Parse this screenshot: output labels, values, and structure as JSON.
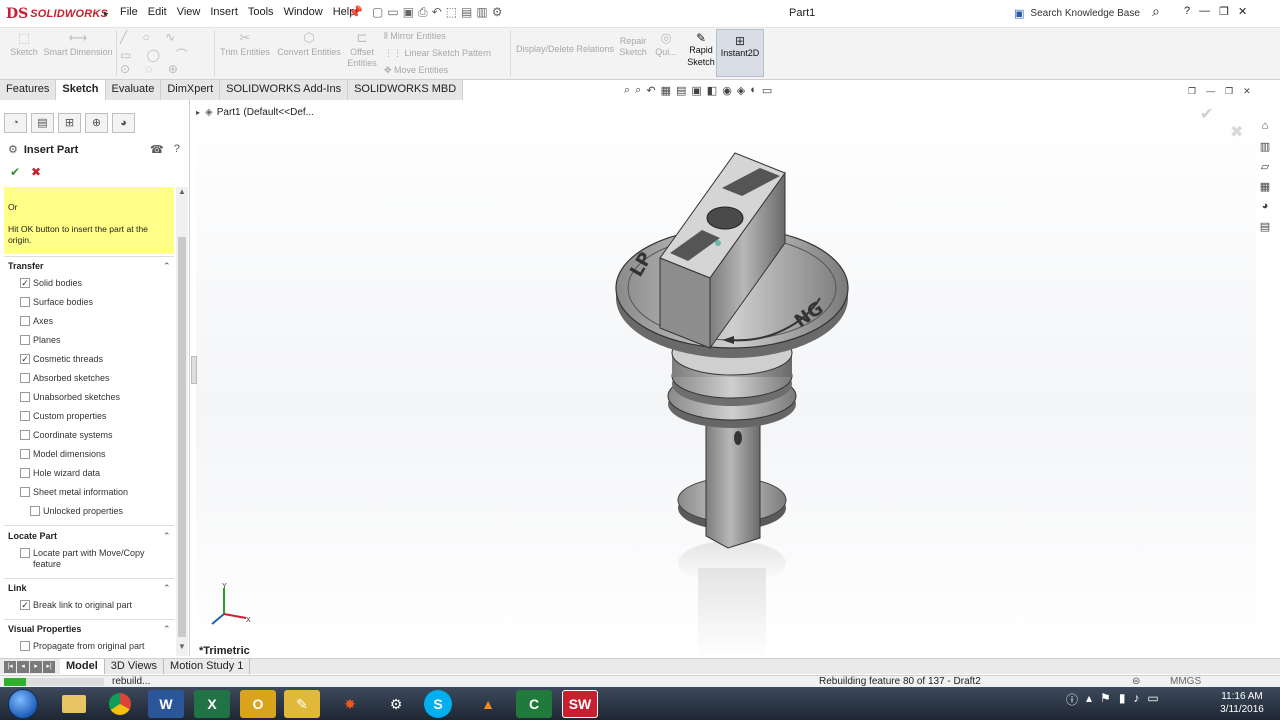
{
  "app": {
    "title": "Part1",
    "logo_ds": "DS",
    "logo_text": "SOLIDWORKS",
    "menus": [
      "File",
      "Edit",
      "View",
      "Insert",
      "Tools",
      "Window",
      "Help"
    ],
    "search_placeholder": "Search Knowledge Base",
    "help_label": "?"
  },
  "ribbon": {
    "sketch": "Sketch",
    "smart_dimension": "Smart Dimension",
    "trim": "Trim Entities",
    "convert": "Convert Entities",
    "offset_1": "Offset",
    "offset_2": "Entities",
    "mirror": "Mirror Entities",
    "linear_pattern": "Linear Sketch Pattern",
    "move": "Move Entities",
    "display_delete": "Display/Delete Relations",
    "repair_1": "Repair",
    "repair_2": "Sketch",
    "quick": "Qui...",
    "rapid_1": "Rapid",
    "rapid_2": "Sketch",
    "instant2d": "Instant2D"
  },
  "tabs": [
    "Features",
    "Sketch",
    "Evaluate",
    "DimXpert",
    "SOLIDWORKS Add-Ins",
    "SOLIDWORKS MBD"
  ],
  "active_tab": "Sketch",
  "tree": {
    "root": "Part1  (Default<<Def..."
  },
  "property_manager": {
    "title": "Insert Part",
    "message_or": "Or",
    "message_body": "Hit OK button to insert the part at the origin.",
    "transfer_title": "Transfer",
    "transfer_items": [
      {
        "label": "Solid bodies",
        "checked": true
      },
      {
        "label": "Surface bodies",
        "checked": false
      },
      {
        "label": "Axes",
        "checked": false
      },
      {
        "label": "Planes",
        "checked": false
      },
      {
        "label": "Cosmetic threads",
        "checked": true
      },
      {
        "label": "Absorbed sketches",
        "checked": false
      },
      {
        "label": "Unabsorbed sketches",
        "checked": false
      },
      {
        "label": "Custom properties",
        "checked": false
      },
      {
        "label": "Coordinate systems",
        "checked": false
      },
      {
        "label": "Model dimensions",
        "checked": false
      },
      {
        "label": "Hole wizard data",
        "checked": false
      },
      {
        "label": "Sheet metal information",
        "checked": false
      }
    ],
    "unlocked_properties": "Unlocked properties",
    "locate_title": "Locate Part",
    "locate_line1": "Locate part with Move/Copy",
    "locate_line2": "feature",
    "locate_checked": false,
    "link_title": "Link",
    "link_label": "Break link to original part",
    "link_checked": true,
    "visual_title": "Visual Properties",
    "visual_label": "Propagate from original part",
    "visual_checked": false
  },
  "viewport": {
    "view_name": "*Trimetric",
    "model_label_left": "LP",
    "model_label_right": "NG"
  },
  "bottom_tabs": [
    "Model",
    "3D Views",
    "Motion Study 1"
  ],
  "active_bottom_tab": "Model",
  "status": {
    "left": "rebuild...",
    "message": "Rebuilding feature 80 of 137 - Draft2",
    "units": "MMGS",
    "progress": 0.22
  },
  "taskbar": {
    "time": "11:16 AM",
    "date": "3/11/2016",
    "apps": [
      "explorer",
      "chrome",
      "word",
      "excel",
      "outlook",
      "paint",
      "app-star",
      "steam",
      "skype",
      "vlc",
      "camtasia",
      "solidworks"
    ]
  },
  "colors": {
    "brand": "#c8202f",
    "highlight": "#ffff88",
    "progress": "#2fb02f"
  }
}
